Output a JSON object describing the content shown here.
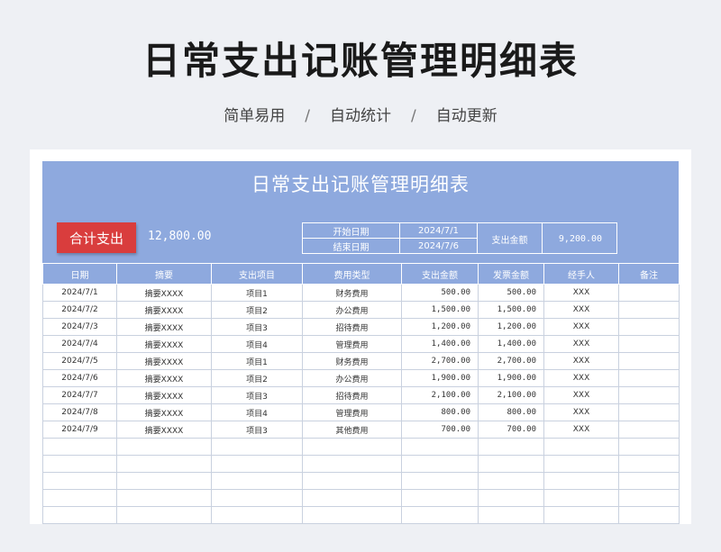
{
  "header": {
    "title": "日常支出记账管理明细表",
    "subtitle_items": [
      "简单易用",
      "自动统计",
      "自动更新"
    ],
    "separator": "/"
  },
  "sheet": {
    "title": "日常支出记账管理明细表",
    "total_label": "合计支出",
    "total_value": "12,800.00",
    "start_label": "开始日期",
    "start_value": "2024/7/1",
    "end_label": "结束日期",
    "end_value": "2024/7/6",
    "amount_label": "支出金额",
    "amount_value": "9,200.00"
  },
  "table": {
    "columns": [
      "日期",
      "摘要",
      "支出项目",
      "费用类型",
      "支出金额",
      "发票金额",
      "经手人",
      "备注"
    ],
    "rows": [
      [
        "2024/7/1",
        "摘要XXXX",
        "项目1",
        "财务费用",
        "500.00",
        "500.00",
        "XXX",
        ""
      ],
      [
        "2024/7/2",
        "摘要XXXX",
        "项目2",
        "办公费用",
        "1,500.00",
        "1,500.00",
        "XXX",
        ""
      ],
      [
        "2024/7/3",
        "摘要XXXX",
        "项目3",
        "招待费用",
        "1,200.00",
        "1,200.00",
        "XXX",
        ""
      ],
      [
        "2024/7/4",
        "摘要XXXX",
        "项目4",
        "管理费用",
        "1,400.00",
        "1,400.00",
        "XXX",
        ""
      ],
      [
        "2024/7/5",
        "摘要XXXX",
        "项目1",
        "财务费用",
        "2,700.00",
        "2,700.00",
        "XXX",
        ""
      ],
      [
        "2024/7/6",
        "摘要XXXX",
        "项目2",
        "办公费用",
        "1,900.00",
        "1,900.00",
        "XXX",
        ""
      ],
      [
        "2024/7/7",
        "摘要XXXX",
        "项目3",
        "招待费用",
        "2,100.00",
        "2,100.00",
        "XXX",
        ""
      ],
      [
        "2024/7/8",
        "摘要XXXX",
        "项目4",
        "管理费用",
        "800.00",
        "800.00",
        "XXX",
        ""
      ],
      [
        "2024/7/9",
        "摘要XXXX",
        "项目3",
        "其他费用",
        "700.00",
        "700.00",
        "XXX",
        ""
      ],
      [
        "",
        "",
        "",
        "",
        "",
        "",
        "",
        ""
      ],
      [
        "",
        "",
        "",
        "",
        "",
        "",
        "",
        ""
      ],
      [
        "",
        "",
        "",
        "",
        "",
        "",
        "",
        ""
      ],
      [
        "",
        "",
        "",
        "",
        "",
        "",
        "",
        ""
      ],
      [
        "",
        "",
        "",
        "",
        "",
        "",
        "",
        ""
      ]
    ]
  },
  "colors": {
    "accent": "#8ea9de",
    "total_button": "#d93d3d"
  }
}
